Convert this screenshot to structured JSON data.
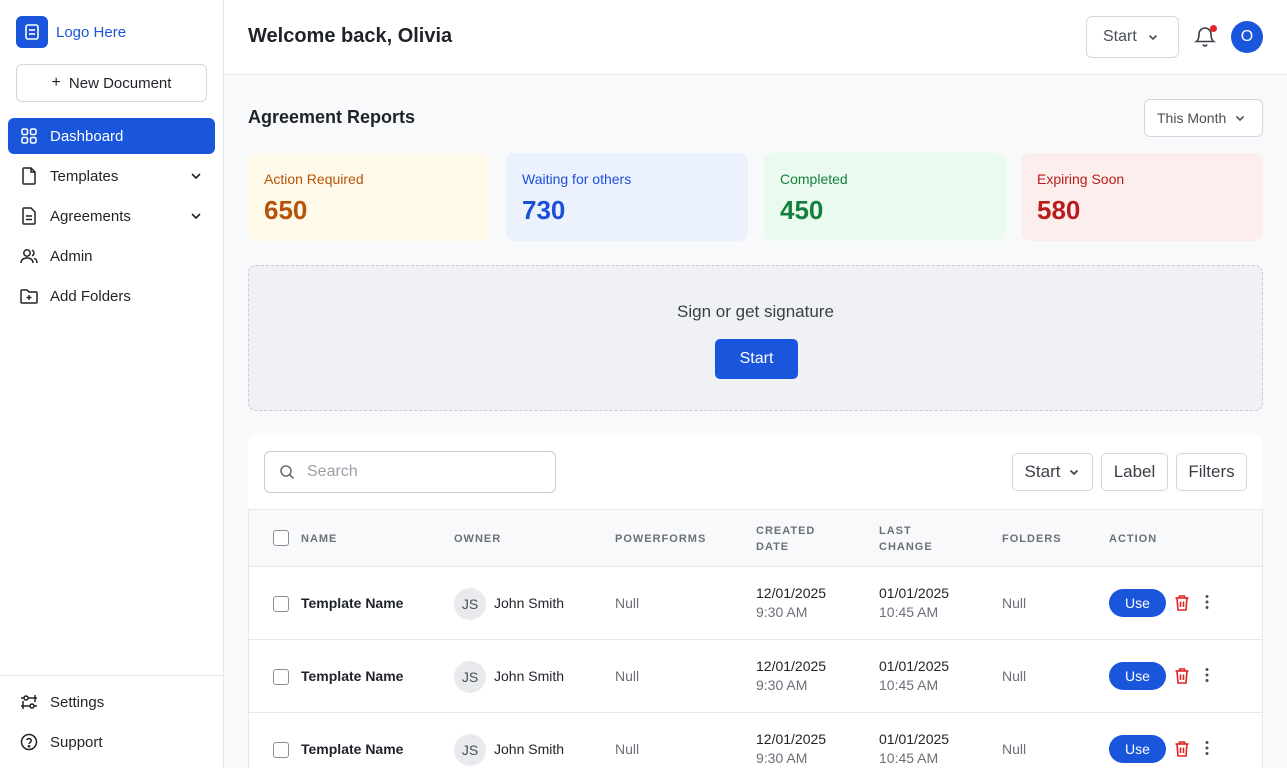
{
  "sidebar": {
    "logo_text": "Logo Here",
    "new_document_label": "New Document",
    "items": [
      {
        "label": "Dashboard",
        "icon": "grid-icon",
        "active": true
      },
      {
        "label": "Templates",
        "icon": "file-icon",
        "expandable": true
      },
      {
        "label": "Agreements",
        "icon": "document-icon",
        "expandable": true
      },
      {
        "label": "Admin",
        "icon": "users-icon"
      },
      {
        "label": "Add Folders",
        "icon": "folder-plus-icon"
      }
    ],
    "bottom_items": [
      {
        "label": "Settings",
        "icon": "settings-icon"
      },
      {
        "label": "Support",
        "icon": "help-icon"
      }
    ]
  },
  "header": {
    "welcome": "Welcome back, Olivia",
    "start_label": "Start",
    "avatar_initial": "O",
    "has_notification": true
  },
  "reports": {
    "title": "Agreement Reports",
    "period": "This Month",
    "cards": [
      {
        "label": "Action Required",
        "value": "650",
        "bg": "#fef9e8",
        "color": "#b45309"
      },
      {
        "label": "Waiting for others",
        "value": "730",
        "bg": "#ebf2fe",
        "color": "#1d4ed8"
      },
      {
        "label": "Completed",
        "value": "450",
        "bg": "#eafaef",
        "color": "#15803d"
      },
      {
        "label": "Expiring Soon",
        "value": "580",
        "bg": "#fdeeee",
        "color": "#b91c1c"
      }
    ]
  },
  "signature": {
    "text": "Sign or get signature",
    "button": "Start"
  },
  "table": {
    "search_placeholder": "Search",
    "start_label": "Start",
    "label_button": "Label",
    "filters_button": "Filters",
    "columns": {
      "name": "Name",
      "owner": "Owner",
      "powerforms": "Powerforms",
      "created": "Created Date",
      "last_change": "Last Change",
      "folders": "Folders",
      "action": "Action"
    },
    "rows": [
      {
        "name": "Template Name",
        "owner_initials": "JS",
        "owner": "John Smith",
        "powerforms": "Null",
        "created_date": "12/01/2025",
        "created_time": "9:30 AM",
        "changed_date": "01/01/2025",
        "changed_time": "10:45 AM",
        "folders": "Null",
        "action": "Use"
      },
      {
        "name": "Template Name",
        "owner_initials": "JS",
        "owner": "John Smith",
        "powerforms": "Null",
        "created_date": "12/01/2025",
        "created_time": "9:30 AM",
        "changed_date": "01/01/2025",
        "changed_time": "10:45 AM",
        "folders": "Null",
        "action": "Use"
      },
      {
        "name": "Template Name",
        "owner_initials": "JS",
        "owner": "John Smith",
        "powerforms": "Null",
        "created_date": "12/01/2025",
        "created_time": "9:30 AM",
        "changed_date": "01/01/2025",
        "changed_time": "10:45 AM",
        "folders": "Null",
        "action": "Use"
      }
    ]
  },
  "colors": {
    "accent": "#1a56db",
    "danger": "#e02424"
  }
}
